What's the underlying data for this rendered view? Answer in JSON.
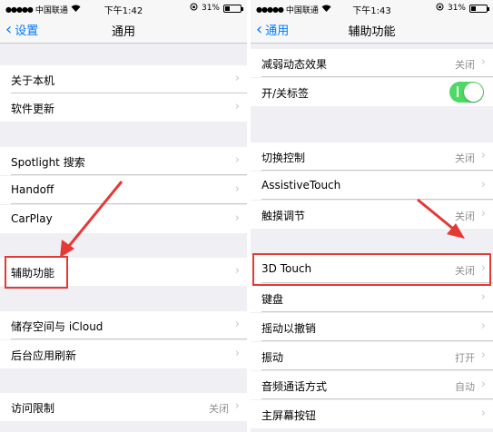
{
  "left": {
    "status": {
      "carrier": "中国联通",
      "time": "下午1:42",
      "battery": "31%",
      "battery_level": 0.31
    },
    "nav": {
      "back_label": "设置",
      "title": "通用"
    },
    "rows": [
      {
        "label": "关于本机",
        "value": ""
      },
      {
        "label": "软件更新",
        "value": ""
      },
      {
        "label": "Spotlight 搜索",
        "value": ""
      },
      {
        "label": "Handoff",
        "value": ""
      },
      {
        "label": "CarPlay",
        "value": ""
      },
      {
        "label": "辅助功能",
        "value": ""
      },
      {
        "label": "储存空间与 iCloud",
        "value": ""
      },
      {
        "label": "后台应用刷新",
        "value": ""
      },
      {
        "label": "访问限制",
        "value": "关闭"
      }
    ]
  },
  "right": {
    "status": {
      "carrier": "中国联通",
      "time": "下午1:43",
      "battery": "31%",
      "battery_level": 0.31
    },
    "nav": {
      "back_label": "通用",
      "title": "辅助功能"
    },
    "rows": [
      {
        "label": "减弱动态效果",
        "value": "关闭"
      },
      {
        "label": "开/关标签",
        "value": ""
      },
      {
        "label": "切换控制",
        "value": "关闭"
      },
      {
        "label": "AssistiveTouch",
        "value": ""
      },
      {
        "label": "触摸调节",
        "value": "关闭"
      },
      {
        "label": "3D Touch",
        "value": "关闭"
      },
      {
        "label": "键盘",
        "value": ""
      },
      {
        "label": "摇动以撤销",
        "value": ""
      },
      {
        "label": "振动",
        "value": "打开"
      },
      {
        "label": "音频通话方式",
        "value": "自动"
      },
      {
        "label": "主屏幕按钮",
        "value": ""
      }
    ],
    "toggle_on": true
  },
  "colors": {
    "accent": "#007aff",
    "toggle": "#4cd964",
    "highlight": "#e53935"
  }
}
